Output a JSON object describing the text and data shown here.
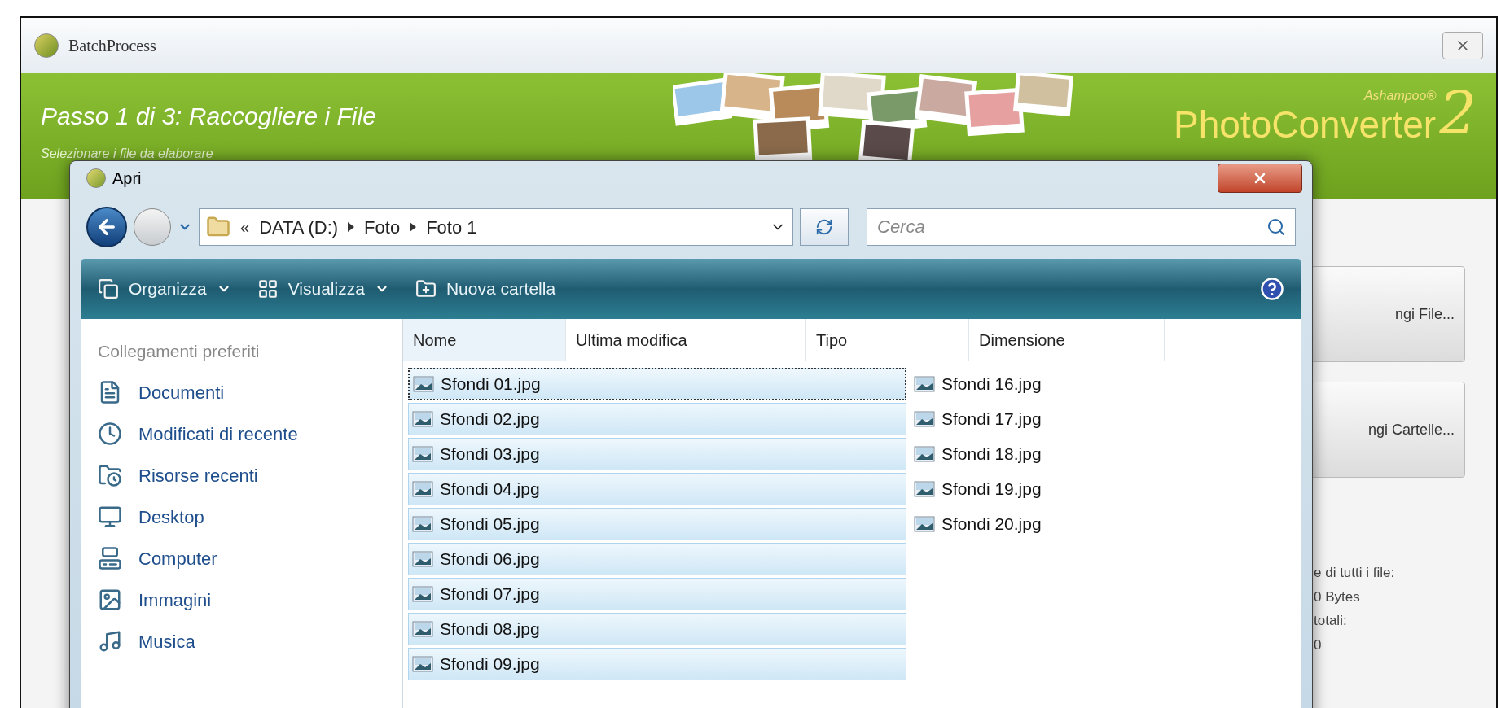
{
  "main_window": {
    "title": "BatchProcess",
    "header": {
      "step_title": "Passo 1 di 3: Raccogliere i File",
      "subtitle": "Selezionare i file da elaborare",
      "brand_small": "Ashampoo®",
      "brand": "PhotoConverter",
      "brand_number": "2"
    },
    "side_panel": {
      "buttons": [
        "ngi File...",
        "ngi Cartelle..."
      ],
      "lines": [
        "e di tutti i file:",
        "0 Bytes",
        "totali:",
        "0"
      ]
    }
  },
  "dialog": {
    "title": "Apri",
    "path_prefix": "«",
    "path": [
      {
        "label": "DATA (D:)"
      },
      {
        "label": "Foto"
      },
      {
        "label": "Foto 1"
      }
    ],
    "search": {
      "placeholder": "Cerca"
    },
    "toolbar": [
      {
        "label": "Organizza",
        "kind": "menu"
      },
      {
        "label": "Visualizza",
        "kind": "views"
      },
      {
        "label": "Nuova cartella",
        "kind": "folder"
      }
    ],
    "sidebar": {
      "heading": "Collegamenti preferiti",
      "items": [
        "Documenti",
        "Modificati di recente",
        "Risorse recenti",
        "Desktop",
        "Computer",
        "Immagini",
        "Musica"
      ]
    },
    "columns": [
      "Nome",
      "Ultima modifica",
      "Tipo",
      "Dimensione"
    ],
    "files": [
      [
        {
          "name": "Sfondi 01.jpg",
          "selected": true,
          "focused": true
        },
        {
          "name": "Sfondi 02.jpg",
          "selected": true,
          "focused": false
        },
        {
          "name": "Sfondi 03.jpg",
          "selected": true,
          "focused": false
        },
        {
          "name": "Sfondi 04.jpg",
          "selected": true,
          "focused": false
        },
        {
          "name": "Sfondi 05.jpg",
          "selected": true,
          "focused": false
        },
        {
          "name": "Sfondi 06.jpg",
          "selected": true,
          "focused": false
        },
        {
          "name": "Sfondi 07.jpg",
          "selected": true,
          "focused": false
        },
        {
          "name": "Sfondi 08.jpg",
          "selected": true,
          "focused": false
        },
        {
          "name": "Sfondi 09.jpg",
          "selected": true,
          "focused": false
        }
      ],
      [
        {
          "name": "Sfondi 16.jpg",
          "selected": false,
          "focused": false
        },
        {
          "name": "Sfondi 17.jpg",
          "selected": false,
          "focused": false
        },
        {
          "name": "Sfondi 18.jpg",
          "selected": false,
          "focused": false
        },
        {
          "name": "Sfondi 19.jpg",
          "selected": false,
          "focused": false
        },
        {
          "name": "Sfondi 20.jpg",
          "selected": false,
          "focused": false
        }
      ]
    ]
  }
}
